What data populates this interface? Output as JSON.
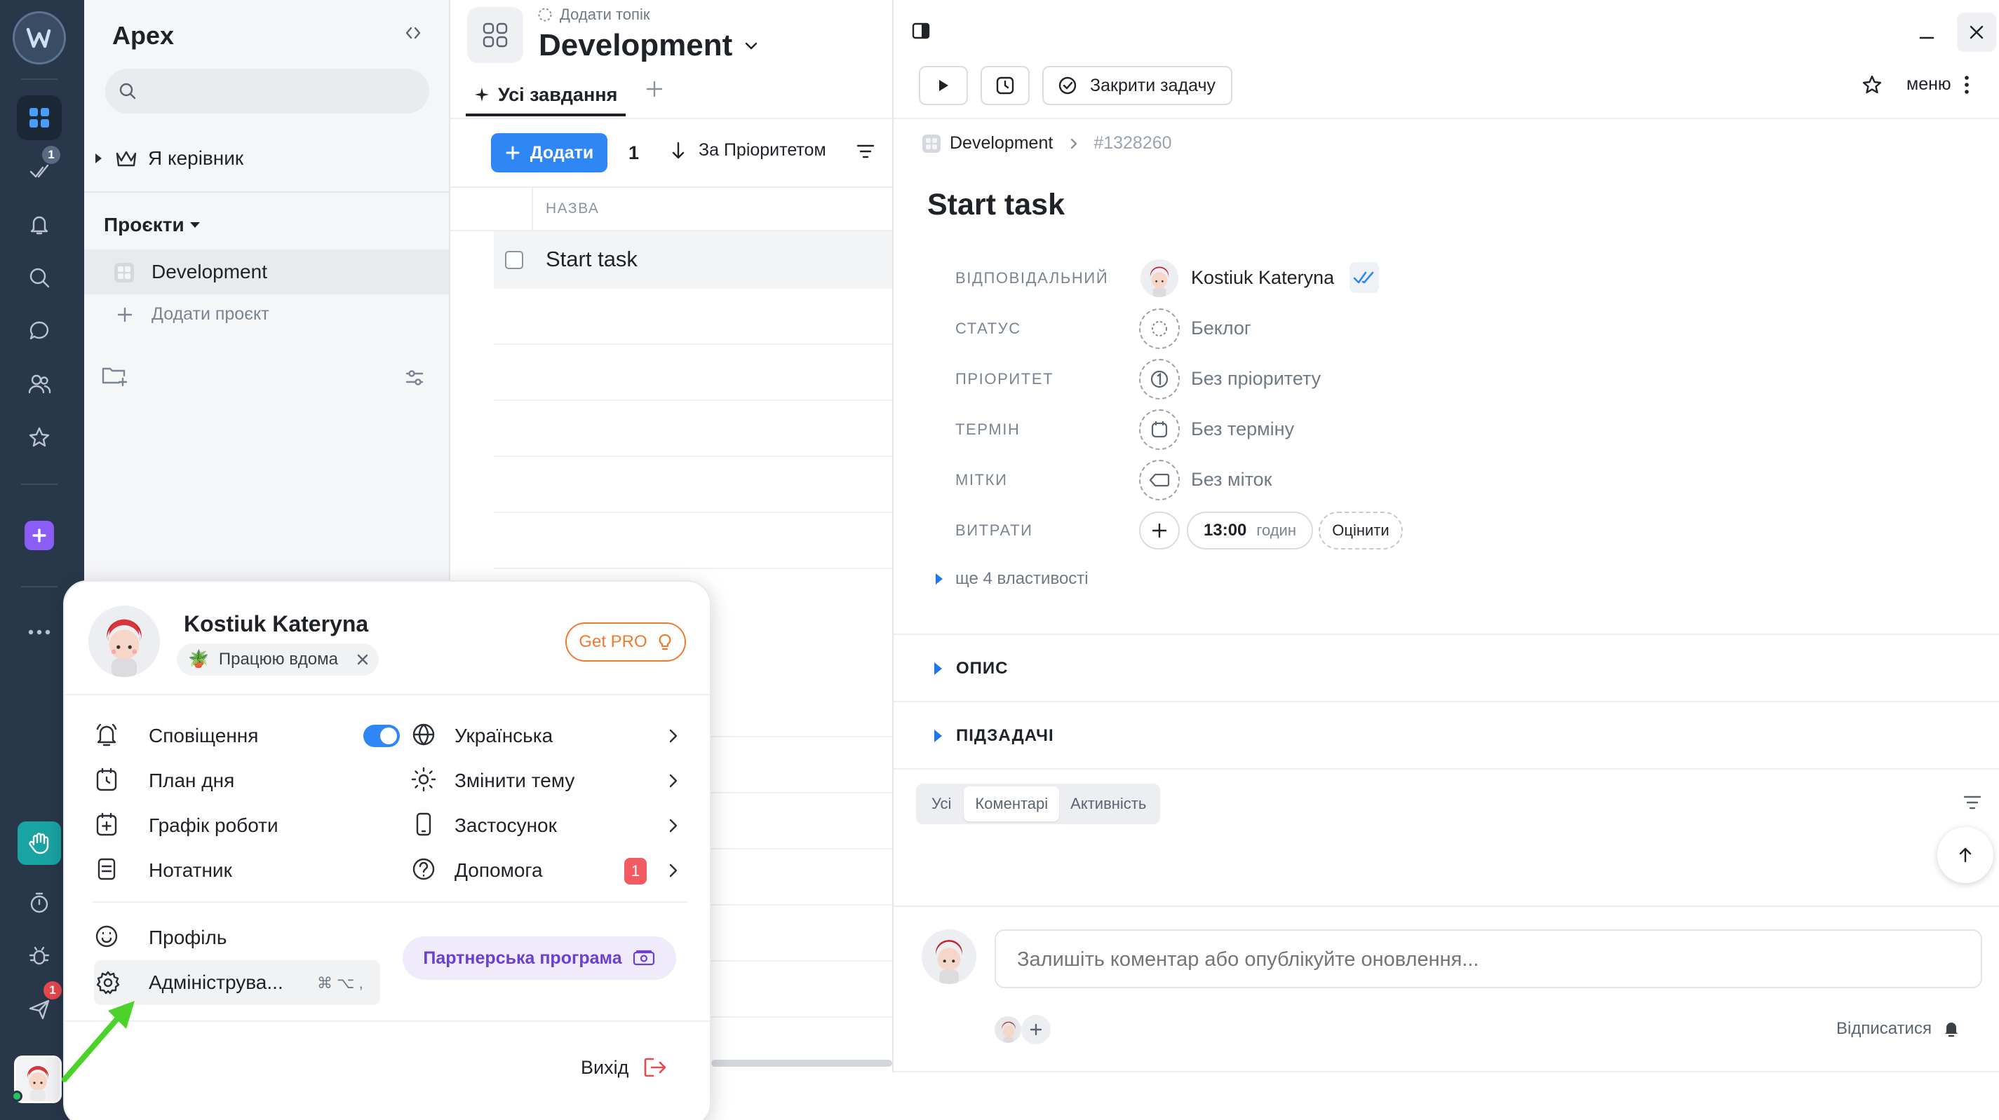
{
  "rail": {
    "badge_tasks": "1",
    "badge_send": "1",
    "colors": {
      "bg": "#28374a",
      "active": "#1e2b3a",
      "accent_plus": "#8b5cf6",
      "hand": "#1aa3a3",
      "badge": "#e5484d"
    }
  },
  "sidebar": {
    "workspace": "Apex",
    "search_placeholder": "",
    "manager_label": "Я керівник",
    "projects_header": "Проєкти",
    "projects": [
      {
        "label": "Development"
      }
    ],
    "add_project": "Додати проєкт"
  },
  "topbar": {
    "add_topic": "Додати топік",
    "project_title": "Development",
    "tab_all": "Усі завдання",
    "add_button": "Додати",
    "count": "1",
    "sort_label": "За Пріоритетом",
    "column_name": "НАЗВА"
  },
  "tasks": [
    {
      "title": "Start task"
    }
  ],
  "detail": {
    "close_task": "Закрити задачу",
    "menu": "меню",
    "breadcrumb_project": "Development",
    "breadcrumb_id": "#1328260",
    "title": "Start task",
    "props": {
      "assignee_label": "ВІДПОВІДАЛЬНИЙ",
      "assignee_value": "Kostiuk Kateryna",
      "status_label": "СТАТУС",
      "status_value": "Беклог",
      "priority_label": "ПРІОРИТЕТ",
      "priority_value": "Без пріоритету",
      "due_label": "ТЕРМІН",
      "due_value": "Без терміну",
      "tags_label": "МІТКИ",
      "tags_value": "Без міток",
      "cost_label": "ВИТРАТИ",
      "cost_time": "13:00",
      "cost_unit": "годин",
      "estimate": "Оцінити"
    },
    "more_props": "ще 4 властивості",
    "section_description": "ОПИС",
    "section_subtasks": "ПІДЗАДАЧІ",
    "filters": [
      "Усі",
      "Коментарі",
      "Активність"
    ],
    "comment_placeholder": "Залишіть коментар або опублікуйте оновлення...",
    "unsubscribe": "Відписатися"
  },
  "popup": {
    "user_name": "Kostiuk Kateryna",
    "status_text": "Працюю вдома",
    "get_pro": "Get PRO",
    "left_items": [
      {
        "label": "Сповіщення"
      },
      {
        "label": "План дня"
      },
      {
        "label": "Графік роботи"
      },
      {
        "label": "Нотатник"
      }
    ],
    "right_items": [
      {
        "label": "Українська"
      },
      {
        "label": "Змінити тему"
      },
      {
        "label": "Застосунок"
      },
      {
        "label": "Допомога",
        "badge": "1"
      }
    ],
    "profile": "Профіль",
    "admin": "Адмініструва...",
    "admin_shortcut": "⌘ ⌥ ,",
    "partner": "Партнерська програма",
    "logout": "Вихід",
    "notifications_on": true
  }
}
